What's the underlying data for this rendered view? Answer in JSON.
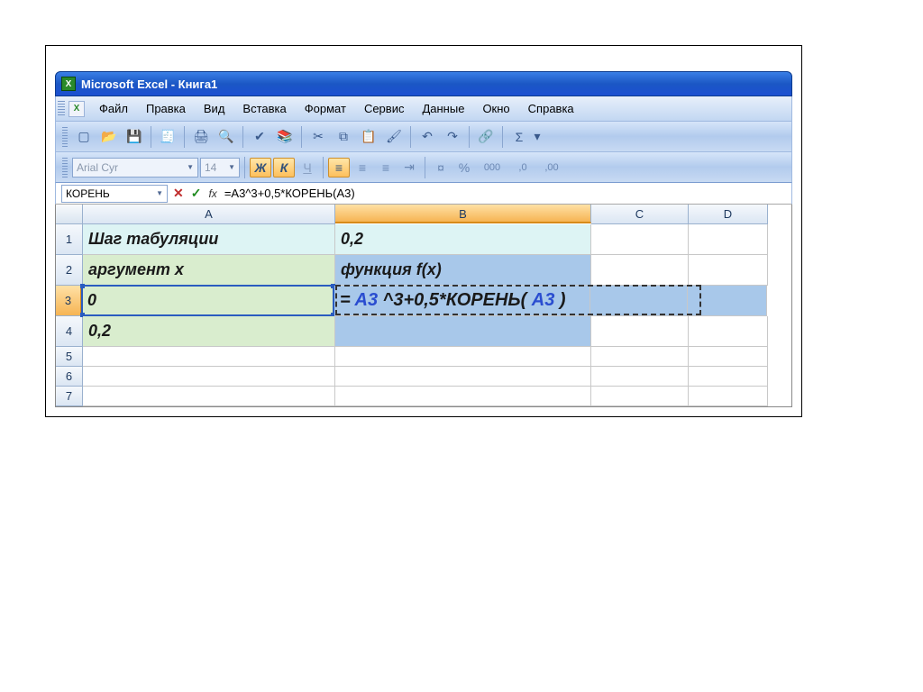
{
  "title": "Microsoft Excel - Книга1",
  "menu": {
    "file": "Файл",
    "edit": "Правка",
    "view": "Вид",
    "insert": "Вставка",
    "format": "Формат",
    "tools": "Сервис",
    "data": "Данные",
    "window": "Окно",
    "help": "Справка"
  },
  "format_toolbar": {
    "font_name": "Arial Cyr",
    "font_size": "14",
    "bold": "Ж",
    "italic": "К",
    "underline": "Ч",
    "currency": "%",
    "thousands": "000",
    "dec_inc": ",0",
    "dec_dec": ",00"
  },
  "formula_bar": {
    "name_box": "КОРЕНЬ",
    "fx": "fx",
    "formula": "=A3^3+0,5*КОРЕНЬ(A3)"
  },
  "columns": [
    "A",
    "B",
    "C",
    "D"
  ],
  "rows": [
    "1",
    "2",
    "3",
    "4",
    "5",
    "6",
    "7"
  ],
  "cells": {
    "a1": "Шаг табуляции",
    "b1": "0,2",
    "a2": "аргумент x",
    "b2": "функция f(x)",
    "a3": "0",
    "a4": "0,2"
  },
  "edit_formula": {
    "prefix": "= ",
    "ref1": "A3",
    "mid": " ^3+0,5*КОРЕНЬ( ",
    "ref2": "A3",
    "suffix": " )"
  },
  "autosum": "Σ"
}
